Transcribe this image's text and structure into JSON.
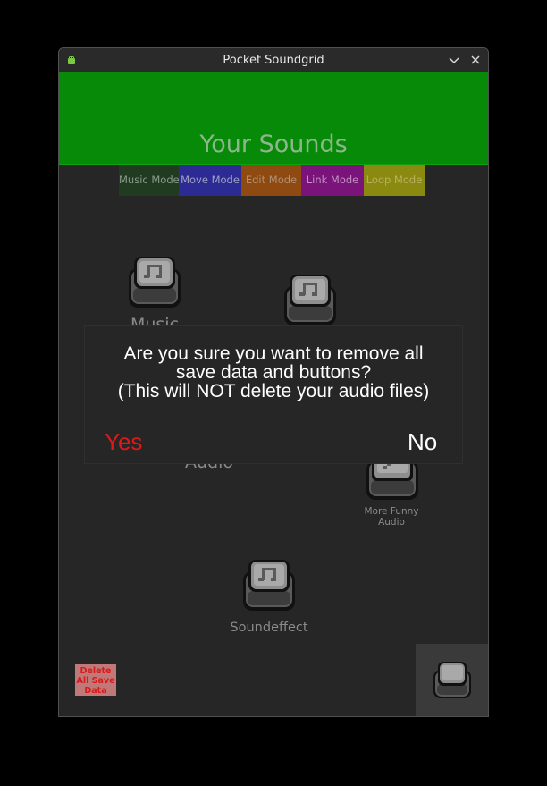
{
  "window": {
    "title": "Pocket Soundgrid",
    "icons": {
      "app": "android-icon",
      "minimize": "chevron-down-icon",
      "close": "close-icon"
    }
  },
  "header": {
    "title": "Your Sounds",
    "color": "#078a07"
  },
  "modes": [
    {
      "label": "Music Mode",
      "color": "#213b21"
    },
    {
      "label": "Move Mode",
      "color": "#2b2b93"
    },
    {
      "label": "Edit Mode",
      "color": "#8f4a12"
    },
    {
      "label": "Link Mode",
      "color": "#7a147a"
    },
    {
      "label": "Loop Mode",
      "color": "#8b8a10"
    }
  ],
  "sounds": [
    {
      "label": "Music",
      "icon": "music-note-icon"
    },
    {
      "label": "",
      "icon": "music-note-icon"
    },
    {
      "label": "Audio",
      "icon": ""
    },
    {
      "label": "More Funny Audio",
      "label_lines": [
        "More Funny",
        "Audio"
      ],
      "icon": "pencil-icon"
    },
    {
      "label": "Soundeffect",
      "icon": "music-note-icon"
    }
  ],
  "dialog": {
    "lines": [
      "Are you sure you want to remove all",
      "save data and buttons?",
      "(This will NOT delete your audio files)"
    ],
    "yes_label": "Yes",
    "no_label": "No",
    "yes_color": "#e01818"
  },
  "delete_button": {
    "lines": [
      "Delete",
      "All Save",
      "Data"
    ]
  },
  "add_button": {
    "icon": "add-button-icon"
  }
}
